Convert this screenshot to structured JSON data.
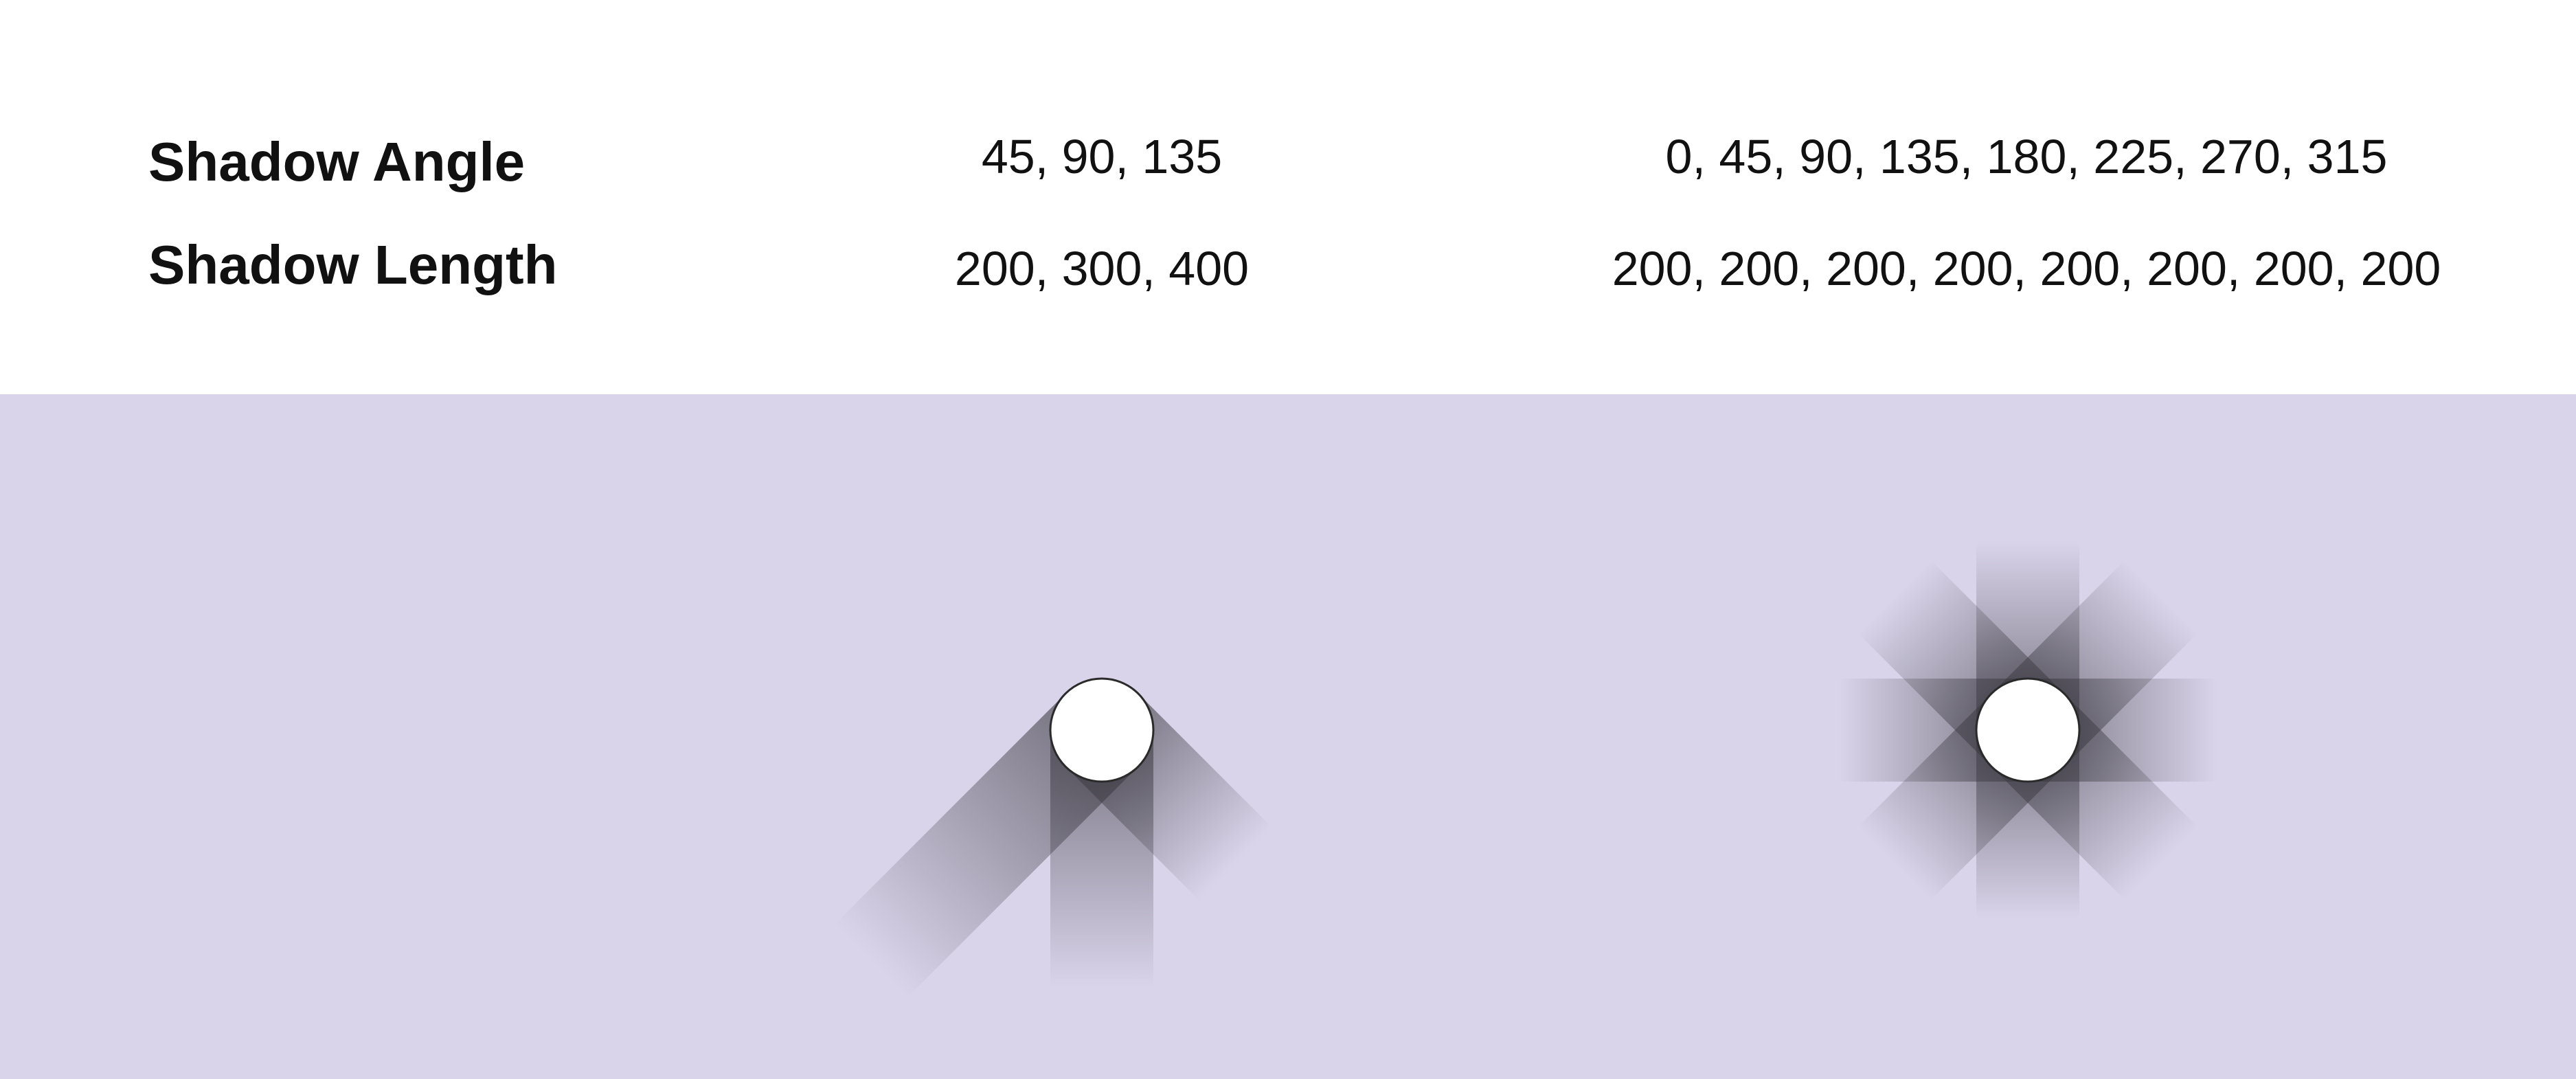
{
  "labels": {
    "angle_label": "Shadow Angle",
    "length_label": "Shadow Length"
  },
  "examples": [
    {
      "angles_text": "45, 90, 135",
      "lengths_text": "200, 300, 400",
      "angles": [
        45,
        90,
        135
      ],
      "lengths": [
        200,
        300,
        400
      ]
    },
    {
      "angles_text": "0, 45, 90, 135, 180, 225, 270, 315",
      "lengths_text": "200, 200, 200, 200, 200, 200, 200, 200",
      "angles": [
        0,
        45,
        90,
        135,
        180,
        225,
        270,
        315
      ],
      "lengths": [
        200,
        200,
        200,
        200,
        200,
        200,
        200,
        200
      ]
    }
  ],
  "colors": {
    "canvas_background": "#d9d4ea",
    "shadow": "#3a3840",
    "circle_fill": "#ffffff",
    "circle_stroke": "#2a2a2a"
  }
}
